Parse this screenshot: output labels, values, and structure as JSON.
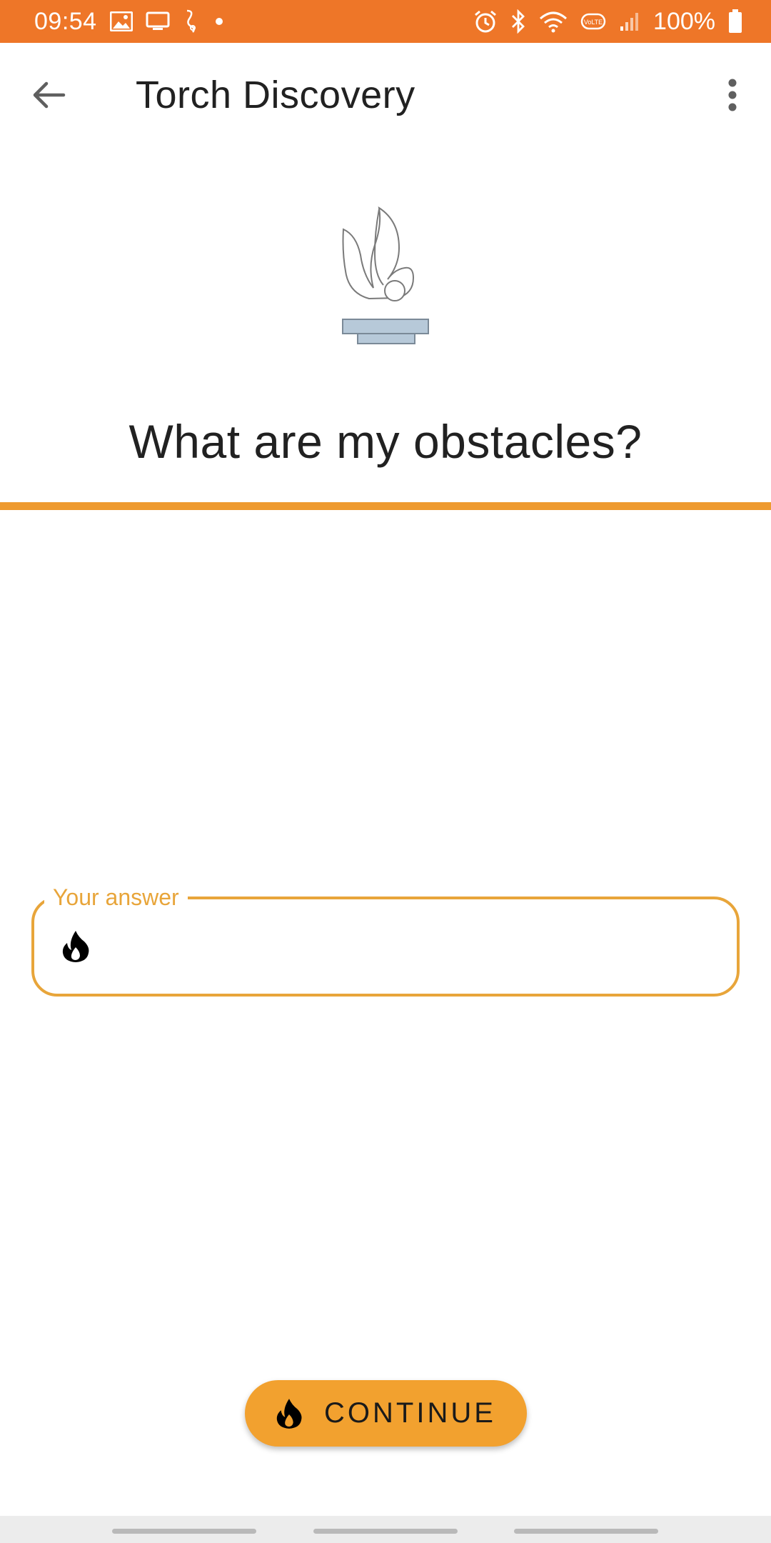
{
  "status_bar": {
    "time": "09:54",
    "battery": "100%",
    "icons": [
      "image-icon",
      "cast-icon",
      "accessibility-icon",
      "dot-icon",
      "alarm-icon",
      "bluetooth-icon",
      "wifi-icon",
      "volte-icon",
      "signal-icon",
      "battery-icon"
    ],
    "background": "#ee7628"
  },
  "app_bar": {
    "title": "Torch Discovery",
    "back_icon": "arrow-left-icon",
    "menu_icon": "more-vert-icon"
  },
  "question": {
    "title": "What are my obstacles?"
  },
  "answer_field": {
    "label": "Your answer",
    "value": "",
    "icon": "flame-icon",
    "accent": "#e8a53a"
  },
  "continue_button": {
    "label": "CONTINUE",
    "icon": "flame-icon",
    "background": "#f2a12f"
  },
  "colors": {
    "divider": "#ee9a2f"
  }
}
